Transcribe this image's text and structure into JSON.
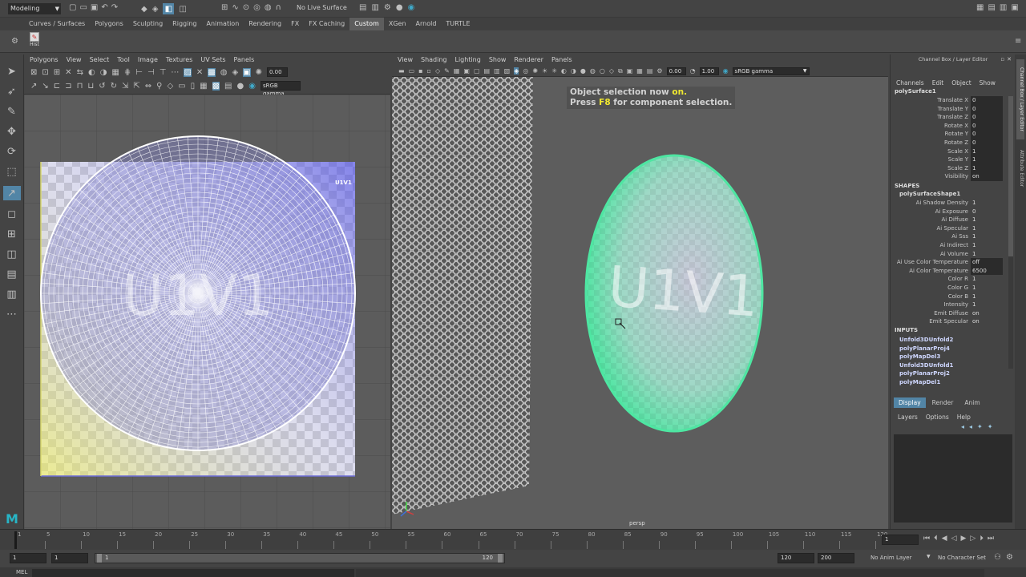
{
  "top": {
    "menu_set": "Modeling",
    "live_surface": "No Live Surface"
  },
  "shelf": {
    "tabs": [
      "Curves / Surfaces",
      "Polygons",
      "Sculpting",
      "Rigging",
      "Animation",
      "Rendering",
      "FX",
      "FX Caching",
      "Custom",
      "XGen",
      "Arnold",
      "TURTLE"
    ],
    "active_tab": "Custom",
    "hist_label": "Hist"
  },
  "uv_editor": {
    "menus": [
      "Polygons",
      "View",
      "Select",
      "Tool",
      "Image",
      "Textures",
      "UV Sets",
      "Panels"
    ],
    "value_field": "0.00",
    "color_space": "sRGB gamma",
    "tile_label": "U1V1",
    "texture_text": "U1V1"
  },
  "viewport": {
    "menus": [
      "View",
      "Shading",
      "Lighting",
      "Show",
      "Renderer",
      "Panels"
    ],
    "field_a": "0.00",
    "field_b": "1.00",
    "color_space": "sRGB gamma",
    "hud_line1_prefix": "Object selection now ",
    "hud_line1_on": "on.",
    "hud_line2_prefix": "Press ",
    "hud_line2_key": "F8",
    "hud_line2_suffix": " for component selection.",
    "camera_label": "persp",
    "texture_text": "U1V1"
  },
  "channel_box": {
    "title": "Channel Box / Layer Editor",
    "menus": [
      "Channels",
      "Edit",
      "Object",
      "Show"
    ],
    "object_name": "polySurface1",
    "transform_attrs": [
      {
        "name": "Translate X",
        "value": "0"
      },
      {
        "name": "Translate Y",
        "value": "0"
      },
      {
        "name": "Translate Z",
        "value": "0"
      },
      {
        "name": "Rotate X",
        "value": "0"
      },
      {
        "name": "Rotate Y",
        "value": "0"
      },
      {
        "name": "Rotate Z",
        "value": "0"
      },
      {
        "name": "Scale X",
        "value": "1"
      },
      {
        "name": "Scale Y",
        "value": "1"
      },
      {
        "name": "Scale Z",
        "value": "1"
      },
      {
        "name": "Visibility",
        "value": "on"
      }
    ],
    "shapes_header": "SHAPES",
    "shape_name": "polySurfaceShape1",
    "shape_attrs": [
      {
        "name": "Ai Shadow Density",
        "value": "1"
      },
      {
        "name": "Ai Exposure",
        "value": "0"
      },
      {
        "name": "Ai Diffuse",
        "value": "1"
      },
      {
        "name": "Ai Specular",
        "value": "1"
      },
      {
        "name": "Ai Sss",
        "value": "1"
      },
      {
        "name": "Ai Indirect",
        "value": "1"
      },
      {
        "name": "Ai Volume",
        "value": "1"
      },
      {
        "name": "Ai Use Color Temperature",
        "value": "off"
      },
      {
        "name": "Ai Color Temperature",
        "value": "6500"
      },
      {
        "name": "Color R",
        "value": "1"
      },
      {
        "name": "Color G",
        "value": "1"
      },
      {
        "name": "Color B",
        "value": "1"
      },
      {
        "name": "Intensity",
        "value": "1"
      },
      {
        "name": "Emit Diffuse",
        "value": "on"
      },
      {
        "name": "Emit Specular",
        "value": "on"
      }
    ],
    "inputs_header": "INPUTS",
    "inputs": [
      "Unfold3DUnfold2",
      "polyPlanarProj4",
      "polyMapDel3",
      "Unfold3DUnfold1",
      "polyPlanarProj2",
      "polyMapDel1"
    ],
    "layer_tabs": [
      "Display",
      "Render",
      "Anim"
    ],
    "active_layer_tab": "Display",
    "layer_menus": [
      "Layers",
      "Options",
      "Help"
    ],
    "side_tab_1": "Channel Box / Layer Editor",
    "side_tab_2": "Attribute Editor"
  },
  "timeline": {
    "ticks": [
      "1",
      "5",
      "10",
      "15",
      "20",
      "25",
      "30",
      "35",
      "40",
      "45",
      "50",
      "55",
      "60",
      "65",
      "70",
      "75",
      "80",
      "85",
      "90",
      "95",
      "100",
      "105",
      "110",
      "115",
      "120"
    ],
    "current_frame": "1"
  },
  "range": {
    "start": "1",
    "playback_start": "1",
    "slider_start": "1",
    "slider_end": "120",
    "playback_end": "120",
    "end": "200",
    "anim_layer": "No Anim Layer",
    "char_set": "No Character Set"
  },
  "cmdline": {
    "label": "MEL"
  },
  "colors": {
    "accent": "#5285a6",
    "hud_highlight": "#f0e830",
    "sphere_edge": "#4ee6a2"
  }
}
